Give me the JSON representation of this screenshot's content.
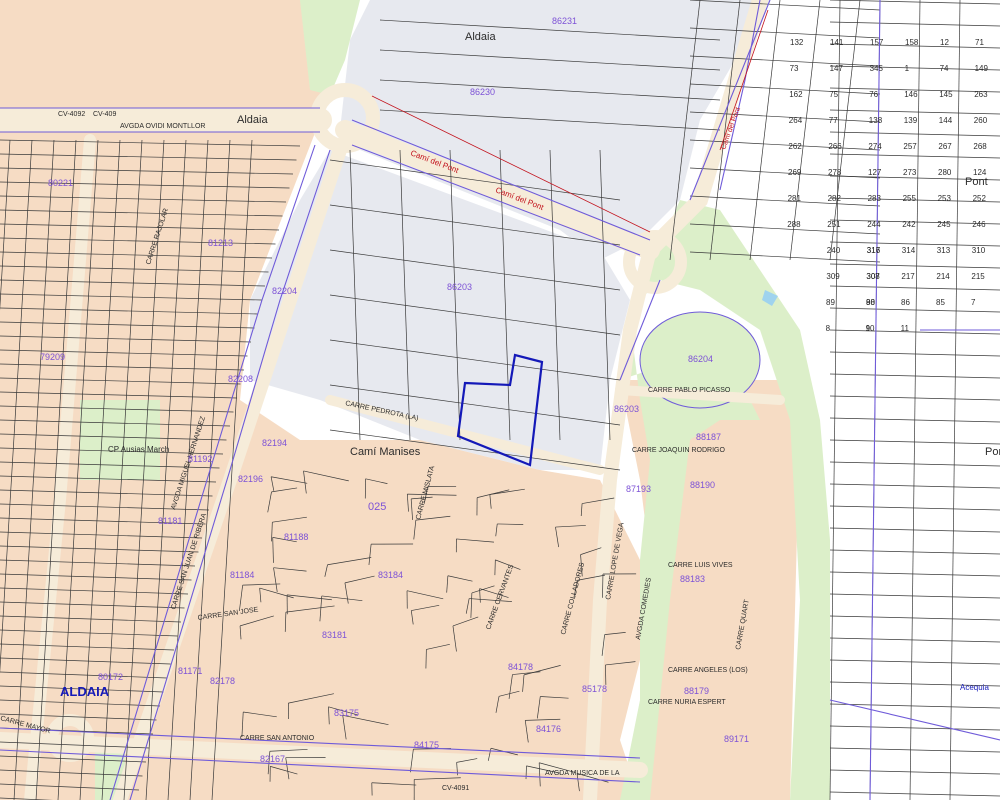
{
  "map": {
    "colors": {
      "urban_block": "#f6dcc4",
      "industrial_block": "#e7e9ef",
      "rural_parcel": "#ffffff",
      "road": "#f6ecd9",
      "green": "#dcefc9",
      "parcel_line": "#3a3a3a",
      "cadastral_line": "#6f5bd9",
      "highlight": "#1419b8",
      "street_label": "#2c2c2c",
      "parcel_label": "#7d52d6",
      "red_label": "#c2121c"
    },
    "labels": {
      "town_north": "Aldaia",
      "town_main": "ALDAIA",
      "avgda_ovidi": "AVGDA OVIDI MONTLLOR",
      "aldaia_road": "Aldaia",
      "cv4092": "CV-4092",
      "cv409": "CV-409",
      "cami_pont_1": "Camí del Pont",
      "cami_pont_2": "Camí del Pont",
      "cami_manises": "Camí Manises",
      "pont_label": "Pont",
      "pont_label_2": "Pont",
      "carre_pedrota": "CARRE PEDROTA (LA)",
      "carre_picasso": "CARRE PABLO PICASSO",
      "carre_rodrigo": "CARRE JOAQUIN RODRIGO",
      "carre_vives": "CARRE LUIS VIVES",
      "carre_angeles": "CARRE ANGELES (LOS)",
      "carre_nuria": "CARRE NURIA ESPERT",
      "carre_quart": "CARRE QUART",
      "carre_santonio": "CARRE SAN ANTONIO",
      "carre_sanjose": "CARRE SAN JOSE",
      "carre_mislata": "CARRE MISLATA",
      "carre_rajolar": "CARRE RAJOLAR",
      "avgda_hernandez": "AVGDA MIGUEL HERNANDEZ",
      "carre_ribera": "CARRE SAN JUAN DE RIBERA",
      "carre_comedies": "AVGDA COMEDIES",
      "carre_lopevega": "CARRE LOPE DE VEGA",
      "carre_colladores": "CARRE COLLADORES",
      "carre_cervantes": "CARRE CERVANTES",
      "carre_mayor": "CARRE MAYOR",
      "avgda_musica": "AVGDA MUSICA DE LA",
      "cv4091": "CV-4091",
      "cp_ausias": "CP Ausias March",
      "acequia": "Acequia",
      "canal": "Camí del Pont",
      "ref_86230": "86230",
      "ref_86203": "86203",
      "ref_86204": "86204",
      "ref_86231": "86231",
      "ref_80221": "80221",
      "ref_81213": "81213",
      "ref_82204": "82204",
      "ref_79209": "79209",
      "ref_82208": "82208",
      "ref_82194": "82194",
      "ref_81192": "81192",
      "ref_82196": "82196",
      "ref_81181": "81181",
      "ref_81184": "81184",
      "ref_81171": "81171",
      "ref_80172": "80172",
      "ref_82178": "82178",
      "ref_83181": "83181",
      "ref_84178": "84178",
      "ref_84176": "84176",
      "ref_85178": "85178",
      "ref_88179": "88179",
      "ref_89171": "89171",
      "ref_88183": "88183",
      "ref_88187": "88187",
      "ref_88190": "88190",
      "ref_87193": "87193",
      "ref_86203b": "86203",
      "ref_025": "025",
      "ref_83184": "83184",
      "ref_81188": "81188",
      "ref_84175": "84175",
      "ref_83175": "83175",
      "ref_82167": "82167",
      "rural": [
        "132",
        "141",
        "157",
        "158",
        "12",
        "71",
        "73",
        "147",
        "345",
        "1",
        "74",
        "149",
        "162",
        "75",
        "76",
        "146",
        "145",
        "263",
        "264",
        "77",
        "138",
        "139",
        "144",
        "260",
        "262",
        "266",
        "274",
        "257",
        "267",
        "268",
        "269",
        "278",
        "127",
        "273",
        "280",
        "124",
        "281",
        "282",
        "283",
        "255",
        "253",
        "252",
        "288",
        "251",
        "244",
        "242",
        "245",
        "246",
        "240",
        "317",
        "316",
        "314",
        "313",
        "310",
        "309",
        "308",
        "307",
        "217",
        "214",
        "215",
        "89",
        "90",
        "88",
        "86",
        "85",
        "7",
        "8",
        "9",
        "10",
        "11"
      ]
    }
  }
}
